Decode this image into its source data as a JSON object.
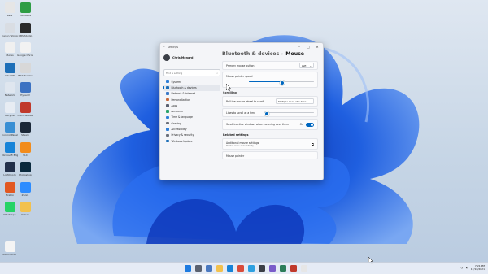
{
  "desktop": {
    "icons": [
      {
        "label": "Pate",
        "color": "#e6e6e6"
      },
      {
        "label": "Camtasia",
        "color": "#2e9d44"
      },
      {
        "label": "Canon Workpad",
        "color": "#d9dde3"
      },
      {
        "label": "OBS Studio",
        "color": "#2b2b2b"
      },
      {
        "label": "iTunes",
        "color": "#f0f0f0"
      },
      {
        "label": "Google Chrome",
        "color": "#f2f2f2"
      },
      {
        "label": "Intel HD",
        "color": "#1d6fb8"
      },
      {
        "label": "Bitdefender",
        "color": "#d8d8d8"
      },
      {
        "label": "Network",
        "color": "#dfe6ef"
      },
      {
        "label": "Hyper-V",
        "color": "#3c72c2"
      },
      {
        "label": "Recycle",
        "color": "#e7ecf3"
      },
      {
        "label": "Cisco Webex",
        "color": "#c0392b"
      },
      {
        "label": "Control Panel",
        "color": "#3a8fd4"
      },
      {
        "label": "Steam",
        "color": "#1b2838"
      },
      {
        "label": "Microsoft Edge",
        "color": "#1683d8"
      },
      {
        "label": "VLC",
        "color": "#f28c1c"
      },
      {
        "label": "Lightroom",
        "color": "#22304a"
      },
      {
        "label": "Photoshop",
        "color": "#0b2a3e"
      },
      {
        "label": "Firefox",
        "color": "#e25822"
      },
      {
        "label": "Zoom",
        "color": "#2d8cff"
      },
      {
        "label": "WhatsApp",
        "color": "#25d366"
      },
      {
        "label": "Videos",
        "color": "#f2c14e"
      },
      {
        "label": "2021-10-17",
        "color": "#f4f4f4"
      }
    ]
  },
  "window": {
    "title": "Settings",
    "back_icon": "←",
    "minimize": "–",
    "maximize": "□",
    "close": "✕",
    "user_name": "Chris Menard",
    "search_placeholder": "Find a setting",
    "search_icon": "⌕",
    "nav": [
      {
        "label": "System",
        "color": "#2f7fd8",
        "selected": false
      },
      {
        "label": "Bluetooth & devices",
        "color": "#1d6fb8",
        "selected": true
      },
      {
        "label": "Network & internet",
        "color": "#3b79c8",
        "selected": false
      },
      {
        "label": "Personalization",
        "color": "#c7683a",
        "selected": false
      },
      {
        "label": "Apps",
        "color": "#5a6070",
        "selected": false
      },
      {
        "label": "Accounts",
        "color": "#2aa36b",
        "selected": false
      },
      {
        "label": "Time & language",
        "color": "#2f7fd8",
        "selected": false
      },
      {
        "label": "Gaming",
        "color": "#6a6f7a",
        "selected": false
      },
      {
        "label": "Accessibility",
        "color": "#2f7fd8",
        "selected": false
      },
      {
        "label": "Privacy & security",
        "color": "#6a6f7a",
        "selected": false
      },
      {
        "label": "Windows Update",
        "color": "#1d6fb8",
        "selected": false
      }
    ],
    "breadcrumb_parent": "Bluetooth & devices",
    "breadcrumb_sep": "›",
    "breadcrumb_current": "Mouse",
    "primary_button_label": "Primary mouse button",
    "primary_button_value": "Left",
    "pointer_speed_label": "Mouse pointer speed",
    "pointer_speed_level": 0.5,
    "scrolling_heading": "Scrolling",
    "roll_label": "Roll the mouse wheel to scroll",
    "roll_value": "Multiple lines at a time",
    "lines_label": "Lines to scroll at a time",
    "lines_level": 0.05,
    "inactive_label": "Scroll inactive windows when hovering over them",
    "inactive_state": "On",
    "related_heading": "Related settings",
    "additional_label": "Additional mouse settings",
    "additional_sub": "Pointer icons and visibility",
    "pointer_label": "Mouse pointer"
  },
  "taskbar": {
    "tray_up": "^",
    "time": "7:21 PM",
    "date": "17/10/2021",
    "apps": [
      "#1e7be0",
      "#5b6270",
      "#4a79c0",
      "#f2c14e",
      "#1683d8",
      "#d94b3a",
      "#2ea0e0",
      "#3b3f47",
      "#7a5cc9",
      "#2c7d5a",
      "#c0392b",
      "#e6e6e6"
    ]
  },
  "colors": {
    "accent": "#0067c0",
    "bloom": "#1f5fe0"
  }
}
